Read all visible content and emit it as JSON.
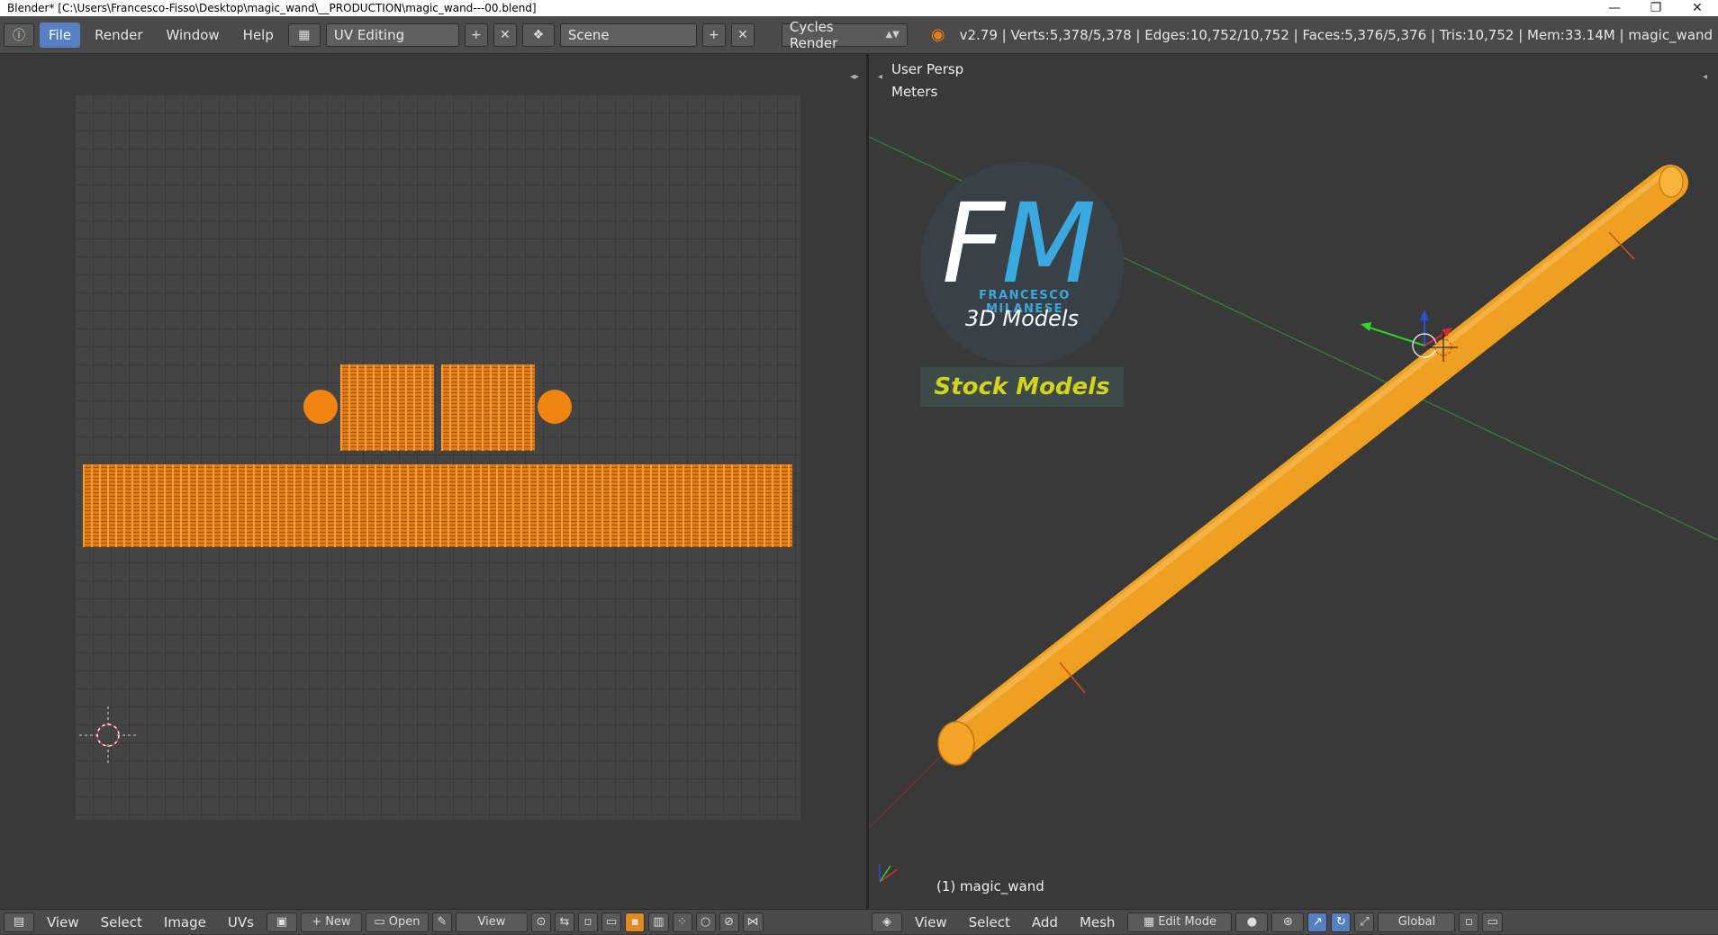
{
  "window": {
    "title": "Blender* [C:\\Users\\Francesco-Fisso\\Desktop\\magic_wand\\__PRODUCTION\\magic_wand---00.blend]",
    "minimize_glyph": "—",
    "maximize_glyph": "❐",
    "close_glyph": "✕"
  },
  "topbar": {
    "menus": [
      "File",
      "Render",
      "Window",
      "Help"
    ],
    "layout": "UV Editing",
    "scene": "Scene",
    "render_engine": "Cycles Render",
    "stats": "v2.79 | Verts:5,378/5,378 | Edges:10,752/10,752 | Faces:5,376/5,376 | Tris:10,752 | Mem:33.14M | magic_wand",
    "icons": [
      "info-icon",
      "layout-icon",
      "scene-icon",
      "blender-logo-icon"
    ]
  },
  "uv_editor": {
    "menus": [
      "View",
      "Select",
      "Image",
      "UVs"
    ],
    "new_label": "New",
    "open_label": "Open",
    "view_label": "View",
    "island_color": "#e07a10"
  },
  "viewport": {
    "view_label": "User Persp",
    "units_label": "Meters",
    "object_label": "(1) magic_wand",
    "menus": [
      "View",
      "Select",
      "Add",
      "Mesh"
    ],
    "mode": "Edit Mode",
    "orientation": "Global",
    "mesh_color": "#f0a020"
  },
  "watermark": {
    "letter_f": "F",
    "letter_m": "M",
    "name": "FRANCESCO MILANESE",
    "subtitle": "3D Models",
    "badge": "Stock Models"
  }
}
